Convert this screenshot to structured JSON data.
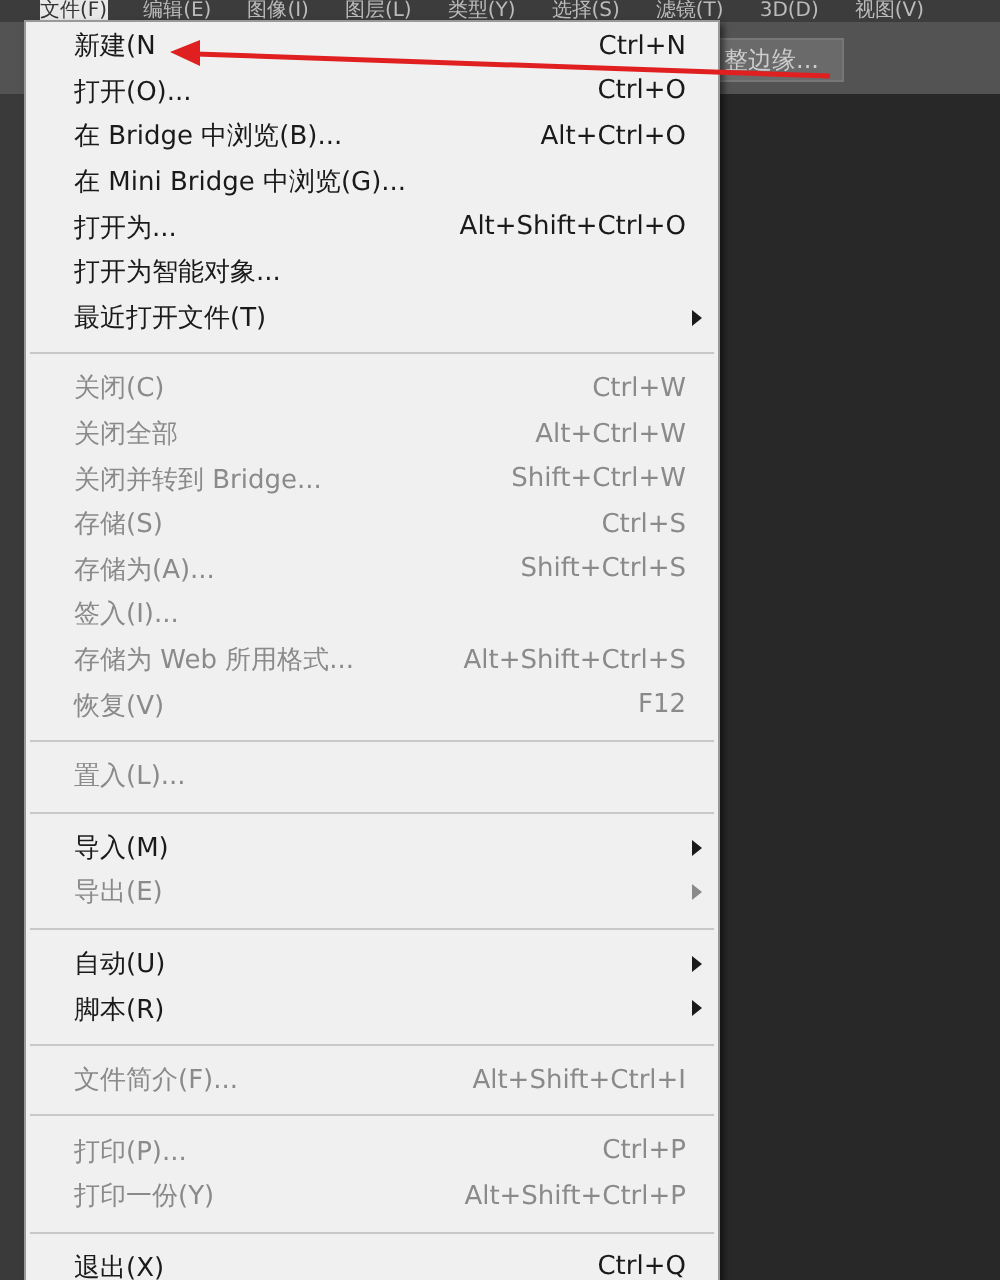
{
  "menu_bar": [
    {
      "label": "文件(F)",
      "selected": true
    },
    {
      "label": "编辑(E)",
      "selected": false
    },
    {
      "label": "图像(I)",
      "selected": false
    },
    {
      "label": "图层(L)",
      "selected": false
    },
    {
      "label": "类型(Y)",
      "selected": false
    },
    {
      "label": "选择(S)",
      "selected": false
    },
    {
      "label": "滤镜(T)",
      "selected": false
    },
    {
      "label": "3D(D)",
      "selected": false
    },
    {
      "label": "视图(V)",
      "selected": false
    }
  ],
  "options_bar": {
    "button": "整边缘..."
  },
  "file_menu": [
    {
      "kind": "item",
      "label": "新建(N",
      "shortcut": "Ctrl+N",
      "disabled": false,
      "submenu": false
    },
    {
      "kind": "item",
      "label": "打开(O)...",
      "shortcut": "Ctrl+O",
      "disabled": false,
      "submenu": false
    },
    {
      "kind": "item",
      "label": "在 Bridge 中浏览(B)...",
      "shortcut": "Alt+Ctrl+O",
      "disabled": false,
      "submenu": false
    },
    {
      "kind": "item",
      "label": "在 Mini Bridge 中浏览(G)...",
      "disabled": false,
      "submenu": false
    },
    {
      "kind": "item",
      "label": "打开为...",
      "shortcut": "Alt+Shift+Ctrl+O",
      "disabled": false,
      "submenu": false
    },
    {
      "kind": "item",
      "label": "打开为智能对象...",
      "disabled": false,
      "submenu": false
    },
    {
      "kind": "item",
      "label": "最近打开文件(T)",
      "disabled": false,
      "submenu": true
    },
    {
      "kind": "separator"
    },
    {
      "kind": "item",
      "label": "关闭(C)",
      "shortcut": "Ctrl+W",
      "disabled": true,
      "submenu": false
    },
    {
      "kind": "item",
      "label": "关闭全部",
      "shortcut": "Alt+Ctrl+W",
      "disabled": true,
      "submenu": false
    },
    {
      "kind": "item",
      "label": "关闭并转到 Bridge...",
      "shortcut": "Shift+Ctrl+W",
      "disabled": true,
      "submenu": false
    },
    {
      "kind": "item",
      "label": "存储(S)",
      "shortcut": "Ctrl+S",
      "disabled": true,
      "submenu": false
    },
    {
      "kind": "item",
      "label": "存储为(A)...",
      "shortcut": "Shift+Ctrl+S",
      "disabled": true,
      "submenu": false
    },
    {
      "kind": "item",
      "label": "签入(I)...",
      "disabled": true,
      "submenu": false
    },
    {
      "kind": "item",
      "label": "存储为 Web 所用格式...",
      "shortcut": "Alt+Shift+Ctrl+S",
      "disabled": true,
      "submenu": false
    },
    {
      "kind": "item",
      "label": "恢复(V)",
      "shortcut": "F12",
      "disabled": true,
      "submenu": false
    },
    {
      "kind": "separator"
    },
    {
      "kind": "item",
      "label": "置入(L)...",
      "disabled": true,
      "submenu": false
    },
    {
      "kind": "separator"
    },
    {
      "kind": "item",
      "label": "导入(M)",
      "disabled": false,
      "submenu": true
    },
    {
      "kind": "item",
      "label": "导出(E)",
      "disabled": true,
      "submenu": true
    },
    {
      "kind": "separator"
    },
    {
      "kind": "item",
      "label": "自动(U)",
      "disabled": false,
      "submenu": true
    },
    {
      "kind": "item",
      "label": "脚本(R)",
      "disabled": false,
      "submenu": true
    },
    {
      "kind": "separator"
    },
    {
      "kind": "item",
      "label": "文件简介(F)...",
      "shortcut": "Alt+Shift+Ctrl+I",
      "disabled": true,
      "submenu": false
    },
    {
      "kind": "separator"
    },
    {
      "kind": "item",
      "label": "打印(P)...",
      "shortcut": "Ctrl+P",
      "disabled": true,
      "submenu": false
    },
    {
      "kind": "item",
      "label": "打印一份(Y)",
      "shortcut": "Alt+Shift+Ctrl+P",
      "disabled": true,
      "submenu": false
    },
    {
      "kind": "separator"
    },
    {
      "kind": "item",
      "label": "退出(X)",
      "shortcut": "Ctrl+Q",
      "disabled": false,
      "submenu": false
    }
  ]
}
